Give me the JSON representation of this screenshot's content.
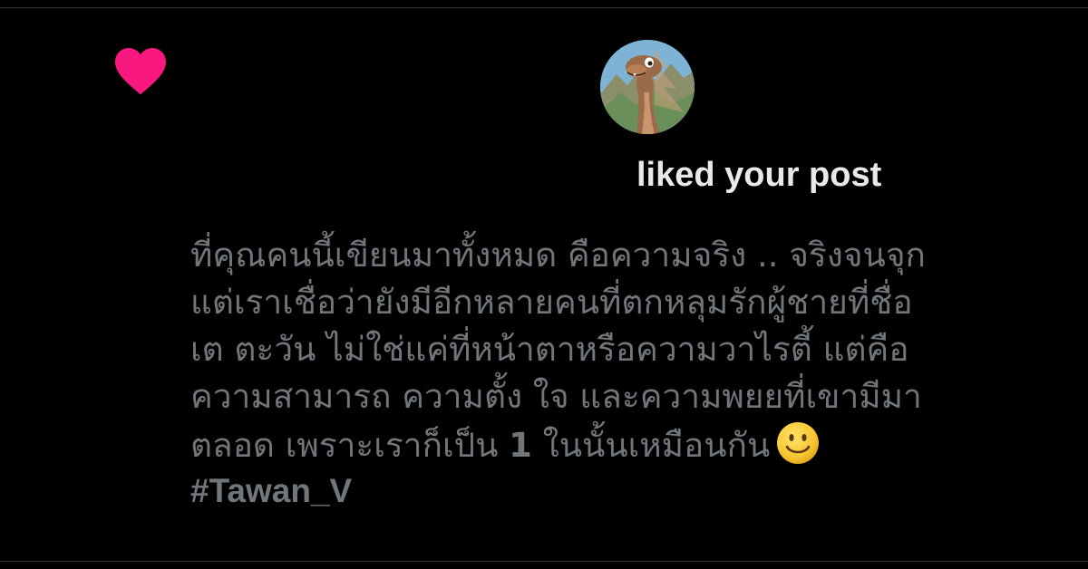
{
  "notification": {
    "type_icon": "heart-icon",
    "action_text": "liked your post",
    "avatar_icon": "dinosaur-avatar-icon"
  },
  "post": {
    "lines": [
      "ที่คุณคนนี้เขียนมาทั้งหมด คือความจริง .. จริงจนจุก",
      "แต่เราเชื่อว่ายังมีอีกหลายคนที่ตกหลุมรักผู้ชายที่ชื่อ",
      "เต ตะวัน ไม่ใช่แค่ที่หน้าตาหรือความวาไรตี้ แต่คือ",
      "ความสามารถ ความตั้ง ใจ และความพยยที่เขามีมา"
    ],
    "last_line_before": "ตลอด เพราะเราก็เป็น ",
    "last_line_number": "1",
    "last_line_after": " ในนั้นเหมือนกัน",
    "emoji": "smiley-icon",
    "hashtag": "#Tawan_V"
  },
  "colors": {
    "background": "#000000",
    "heart": "#f91880",
    "primary_text": "#e7e9ea",
    "secondary_text": "#71767b",
    "divider": "#2f3336"
  }
}
